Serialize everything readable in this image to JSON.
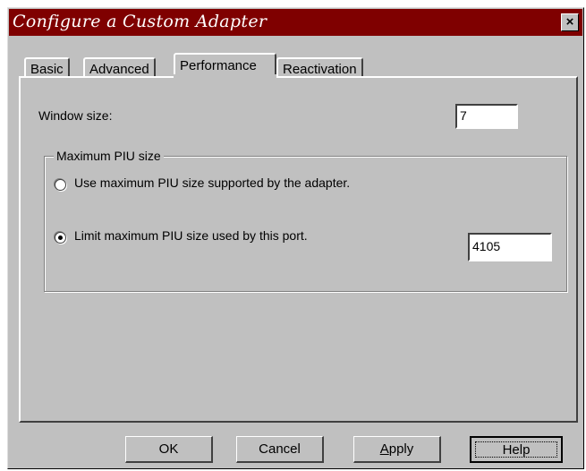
{
  "window": {
    "title": "Configure a Custom Adapter",
    "close_label": "×"
  },
  "tabs": [
    {
      "label": "Basic"
    },
    {
      "label": "Advanced"
    },
    {
      "label": "Performance"
    },
    {
      "label": "Reactivation"
    }
  ],
  "active_tab": "Performance",
  "window_size": {
    "label": "Window size:",
    "value": "7"
  },
  "piu_group": {
    "legend": "Maximum PIU size",
    "option_max": {
      "label": "Use maximum PIU size supported by the adapter.",
      "selected": false
    },
    "option_limit": {
      "label": "Limit maximum PIU size used by this port.",
      "selected": true
    },
    "limit_value": "4105"
  },
  "buttons": {
    "ok": "OK",
    "cancel": "Cancel",
    "apply_mnemonic": "A",
    "apply_rest": "pply",
    "help": "Help"
  },
  "colors": {
    "titlebar": "#7f0000",
    "face": "#c0c0c0"
  }
}
